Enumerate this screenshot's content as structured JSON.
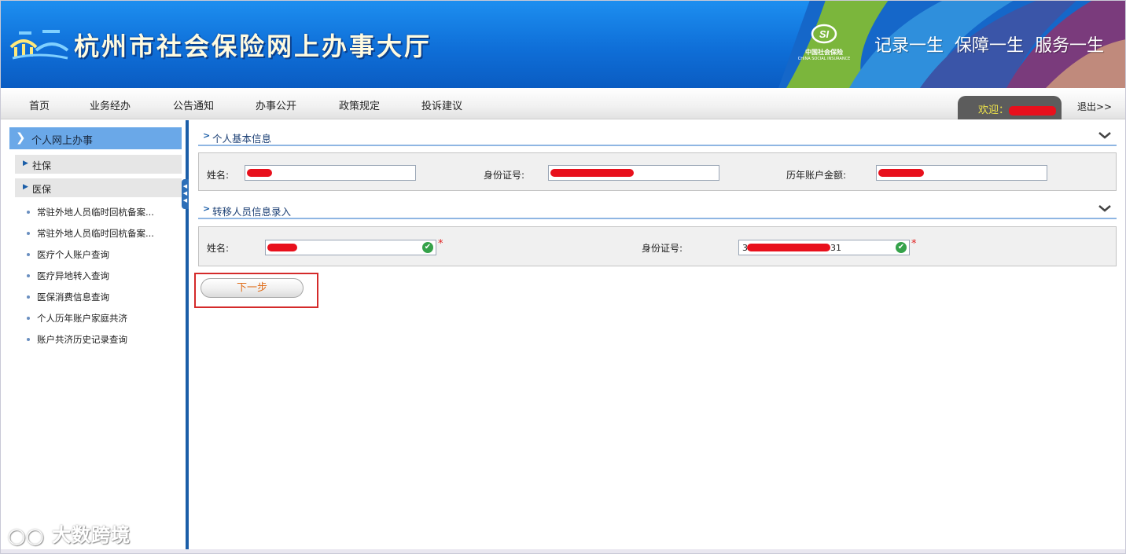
{
  "header": {
    "site_title": "杭州市社会保险网上办事大厅",
    "si_logo_cn": "中国社会保险",
    "si_logo_en": "CHINA SOCIAL INSURANCE",
    "si_logo_mark": "SI",
    "slogans": [
      "记录一生",
      "保障一生",
      "服务一生"
    ]
  },
  "nav": {
    "items": [
      "首页",
      "业务经办",
      "公告通知",
      "办事公开",
      "政策规定",
      "投诉建议"
    ],
    "welcome_label": "欢迎：",
    "logout_label": "退出>>"
  },
  "sidebar": {
    "top_item": "个人网上办事",
    "groups": [
      "社保",
      "医保"
    ],
    "links": [
      "常驻外地人员临时回杭备案...",
      "常驻外地人员临时回杭备案...",
      "医疗个人账户查询",
      "医疗异地转入查询",
      "医保消费信息查询",
      "个人历年账户家庭共济",
      "账户共济历史记录查询"
    ]
  },
  "basic_info": {
    "title": "个人基本信息",
    "name_label": "姓名:",
    "id_label": "身份证号:",
    "balance_label": "历年账户金额:"
  },
  "transfer_info": {
    "title": "转移人员信息录入",
    "name_label": "姓名:",
    "id_label": "身份证号:",
    "id_prefix": "3",
    "id_suffix": "31",
    "required_mark": "*"
  },
  "actions": {
    "next_label": "下一步"
  },
  "watermark": "大数跨境",
  "colors": {
    "header_blue": "#0f6fd8",
    "sidebar_accent": "#1b5ea8",
    "redaction": "#e8101c",
    "next_text": "#e06d1a",
    "highlight_box": "#d42a2a",
    "valid_check": "#35a24a"
  }
}
